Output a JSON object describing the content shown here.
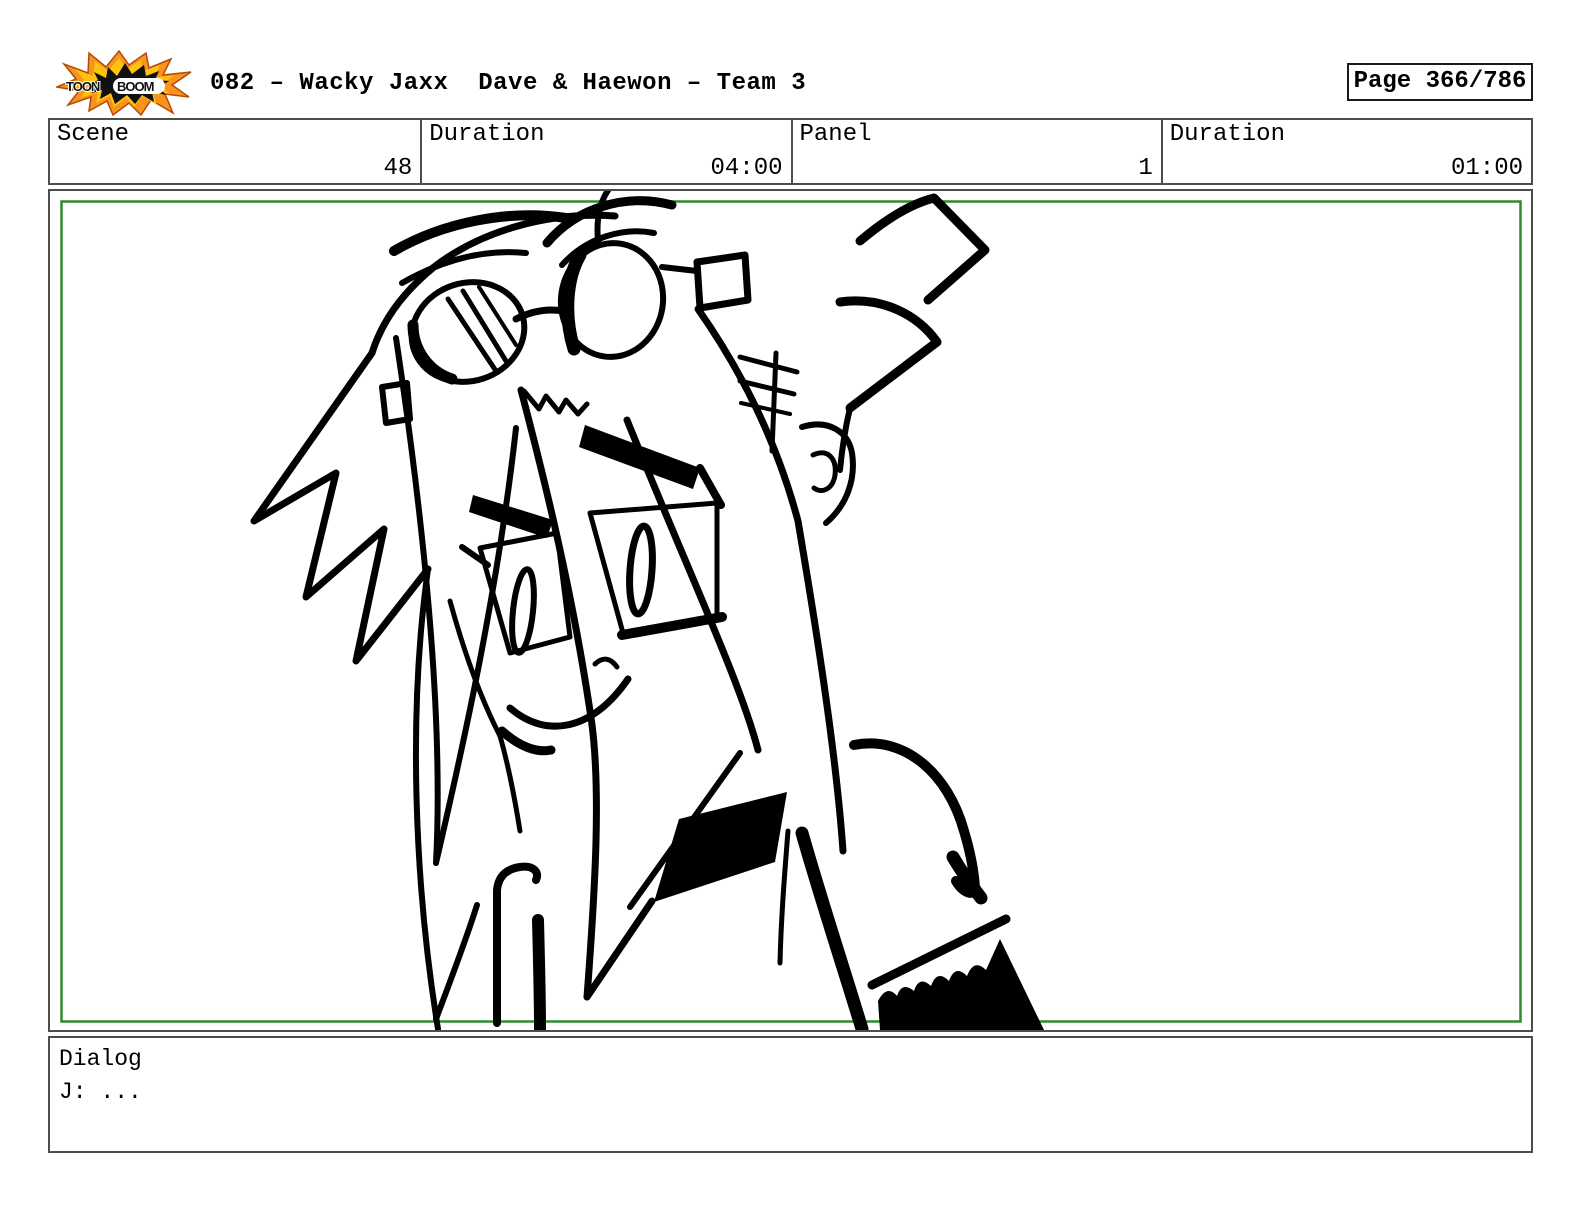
{
  "header": {
    "logo": {
      "text_top": "TOON",
      "text_bottom": "BOOM"
    },
    "title": "082 – Wacky Jaxx  Dave & Haewon – Team 3",
    "page_label": "Page 366/786"
  },
  "info_row": [
    {
      "label": "Scene",
      "value": "48"
    },
    {
      "label": "Duration",
      "value": "04:00"
    },
    {
      "label": "Panel",
      "value": "1"
    },
    {
      "label": "Duration",
      "value": "01:00"
    }
  ],
  "panel": {
    "frame_color": "#2e8b2e",
    "content": "hand-drawn storyboard sketch of spiky-haired character with goggles"
  },
  "dialog": {
    "label": "Dialog",
    "line": "J: ..."
  },
  "colors": {
    "border_gray": "#4d4d4d",
    "ink": "#000000",
    "logo_orange": "#f7941e",
    "logo_yellow": "#ffc20e"
  }
}
